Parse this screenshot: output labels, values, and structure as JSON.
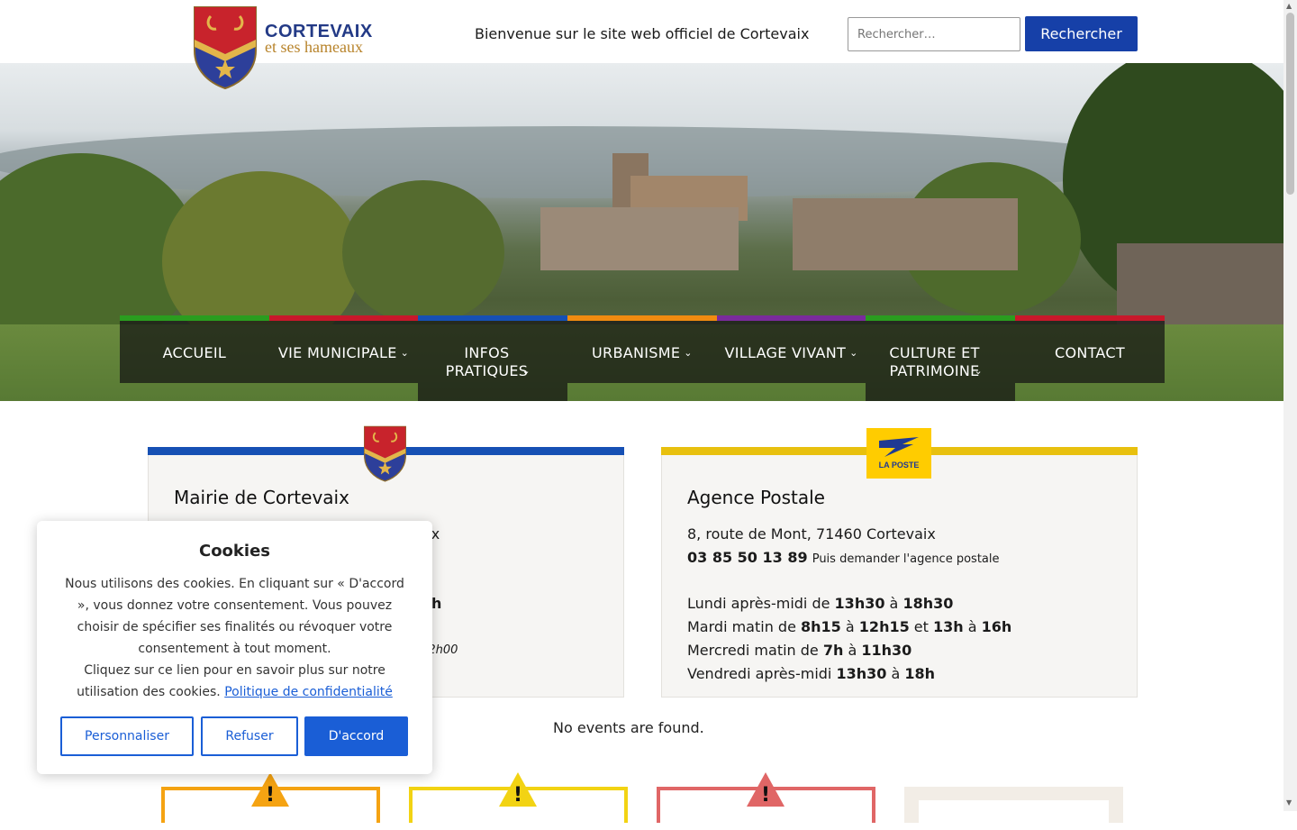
{
  "header": {
    "logo_title": "CORTEVAIX",
    "logo_subtitle": "et ses hameaux",
    "welcome": "Bienvenue sur le site web officiel de Cortevaix",
    "search_placeholder": "Rechercher…",
    "search_button": "Rechercher"
  },
  "nav": [
    {
      "label": "ACCUEIL",
      "color": "#2a9d1f",
      "dropdown": false
    },
    {
      "label": "VIE MUNICIPALE",
      "color": "#c8182b",
      "dropdown": true
    },
    {
      "label": "INFOS PRATIQUES",
      "color": "#1650b4",
      "dropdown": true
    },
    {
      "label": "URBANISME",
      "color": "#f08b10",
      "dropdown": true
    },
    {
      "label": "VILLAGE VIVANT",
      "color": "#7a2b9c",
      "dropdown": true
    },
    {
      "label": "CULTURE ET PATRIMOINE",
      "color": "#2a9d1f",
      "dropdown": true
    },
    {
      "label": "CONTACT",
      "color": "#c8182b",
      "dropdown": false
    }
  ],
  "mairie": {
    "title": "Mairie de Cortevaix",
    "line1": "vaix",
    "line2": "h",
    "line3": "à 12h00",
    "bar_color": "#1650b4"
  },
  "poste": {
    "logo_text": "LA POSTE",
    "title": "Agence Postale",
    "address": "8, route de Mont, 71460 Cortevaix",
    "phone": "03 85 50 13 89",
    "phone_note": "Puis demander l'agence postale",
    "bar_color": "#e8c00e",
    "hours": [
      {
        "pre": "Lundi après-midi de ",
        "a": "13h30",
        "mid": " à ",
        "b": "18h30",
        "rest": ""
      },
      {
        "pre": "Mardi matin de ",
        "a": "8h15",
        "mid": " à ",
        "b": "12h15",
        "rest": " et ",
        "c": "13h",
        "mid2": " à ",
        "d": "16h"
      },
      {
        "pre": "Mercredi matin de ",
        "a": "7h",
        "mid": " à ",
        "b": "11h30",
        "rest": ""
      },
      {
        "pre": "Vendredi après-midi ",
        "a": "13h30",
        "mid": " à ",
        "b": "18h",
        "rest": ""
      }
    ]
  },
  "events": {
    "empty": "No events are found."
  },
  "alerts": [
    {
      "color": "#f5a312"
    },
    {
      "color": "#f2d313"
    },
    {
      "color": "#e06666"
    },
    {
      "color": "#f2ede6"
    }
  ],
  "cookie": {
    "title": "Cookies",
    "text": "Nous utilisons des cookies. En cliquant sur « D'accord », vous donnez votre consentement. Vous pouvez choisir de spécifier ses finalités ou révoquer votre consentement à tout moment.",
    "text2": "Cliquez sur ce lien pour en savoir plus sur notre utilisation des cookies.",
    "link": "Politique de confidentialité",
    "customize": "Personnaliser",
    "refuse": "Refuser",
    "accept": "D'accord"
  }
}
